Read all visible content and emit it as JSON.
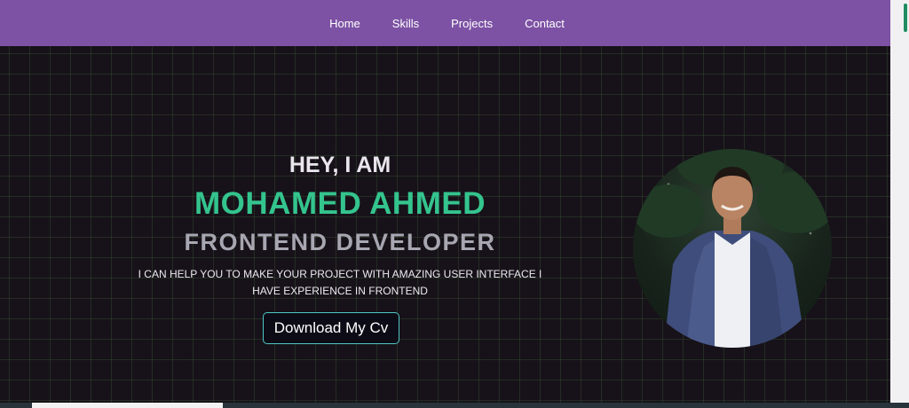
{
  "navbar": {
    "links": [
      "Home",
      "Skills",
      "Projects",
      "Contact"
    ]
  },
  "hero": {
    "greeting": "HEY, I AM",
    "name": "MOHAMED AHMED",
    "role": "FRONTEND DEVELOPER",
    "description": "I CAN HELP YOU TO MAKE YOUR PROJECT WITH AMAZING USER INTERFACE I HAVE EXPERIENCE IN FRONTEND",
    "cv_button": "Download My Cv"
  },
  "colors": {
    "nav_bg": "#7d52a4",
    "accent_green": "#34c48e",
    "page_bg": "#171219",
    "button_border": "#4fc8c4"
  }
}
